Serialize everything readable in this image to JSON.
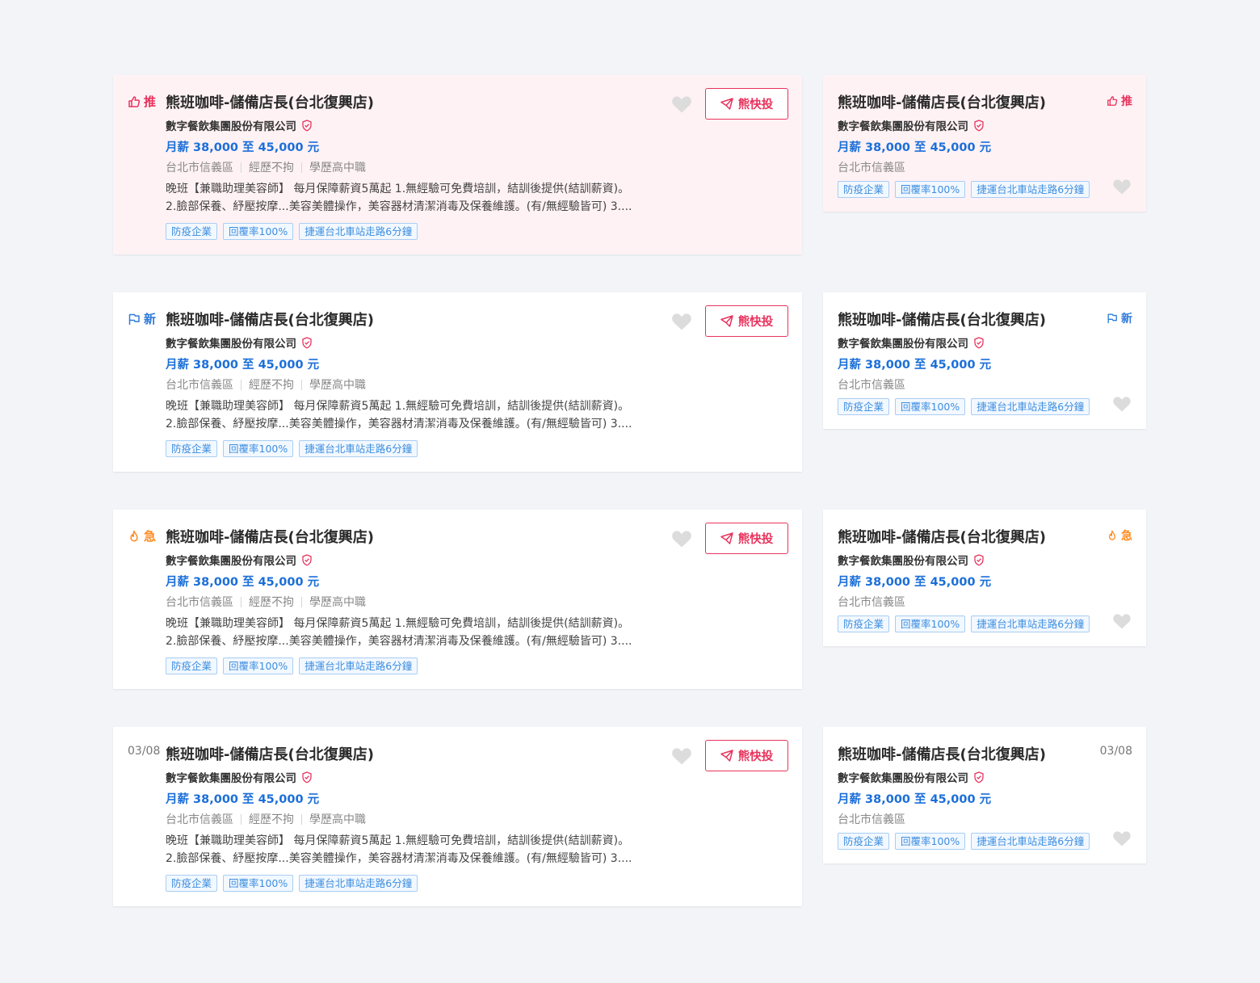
{
  "job": {
    "title": "熊班咖啡-儲備店長(台北復興店)",
    "company": "數字餐飲集團股份有限公司",
    "salary": "月薪 38,000 至 45,000 元",
    "location": "台北市信義區",
    "experience": "經歷不拘",
    "education": "學歷高中職",
    "desc_line1": "晚班【兼職助理美容師】 每月保障薪資5萬起 1.無經驗可免費培訓，結訓後提供(結訓薪資)。",
    "desc_line2": "2.臉部保養、紓壓按摩...美容美體操作，美容器材清潔消毒及保養維護。(有/無經驗皆可) 3....",
    "tags": [
      "防疫企業",
      "回覆率100%",
      "捷運台北車站走路6分鐘"
    ],
    "apply_label": "熊快投"
  },
  "badges": {
    "recommended": "推",
    "new": "新",
    "urgent": "急",
    "date": "03/08"
  },
  "colors": {
    "accent_red": "#e8335d",
    "accent_blue": "#2f7bd9",
    "accent_orange": "#ff8a1f",
    "salary_blue": "#1b6fd9",
    "tag_blue": "#3d8ee0",
    "pink_bg": "#fff2f5"
  },
  "icons": {
    "recommended": "thumbs-up-icon",
    "new": "flag-icon",
    "urgent": "fire-icon",
    "verified": "shield-check-icon",
    "favorite": "heart-icon",
    "apply": "paper-plane-icon"
  }
}
